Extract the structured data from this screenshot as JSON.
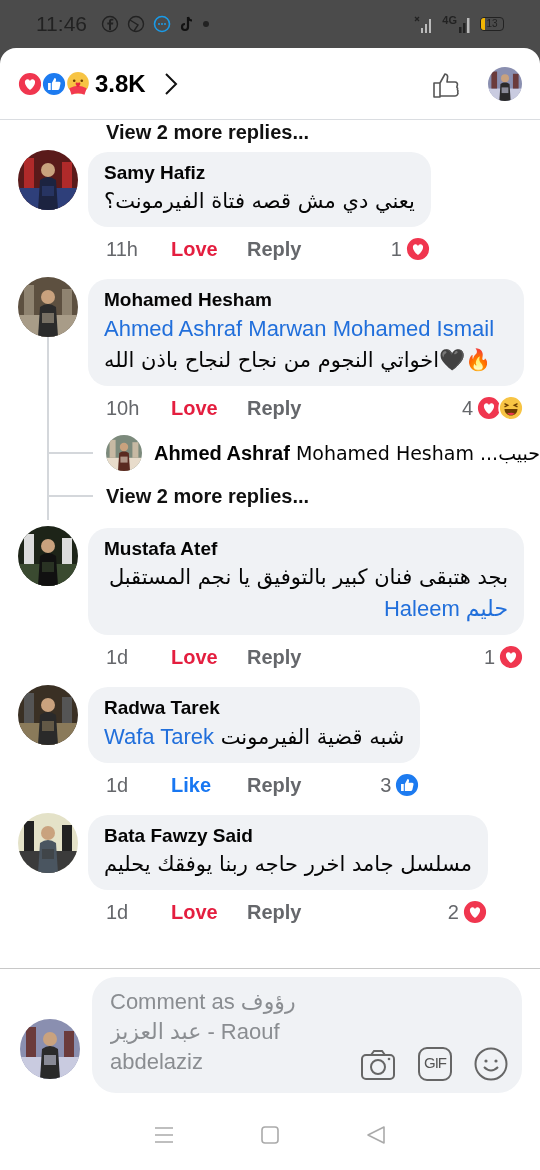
{
  "status_bar": {
    "time": "11:46",
    "network": "4G",
    "battery": "13"
  },
  "reactions_summary": {
    "reactions": [
      {
        "kind": "love"
      },
      {
        "kind": "like"
      },
      {
        "kind": "care"
      }
    ],
    "count": "3.8K"
  },
  "clipped_top_link": "View 2 more replies...",
  "comments": [
    {
      "name": "Samy Hafiz",
      "body": {
        "text": "يعني دي مش قصه فتاة الفيرمونت؟"
      },
      "time": "11h",
      "action": {
        "label": "Love",
        "kind": "love"
      },
      "reply_label": "Reply",
      "count": "1",
      "reactions": [
        {
          "kind": "love"
        }
      ]
    },
    {
      "name": "Mohamed Hesham",
      "body": {
        "mention_before": "Ahmed Ashraf Marwan Mohamed Ismail",
        "text": "اخواتي النجوم من نجاح لنجاح باذن الله🖤🔥"
      },
      "time": "10h",
      "action": {
        "label": "Love",
        "kind": "love"
      },
      "reply_label": "Reply",
      "count": "4",
      "reactions": [
        {
          "kind": "love"
        },
        {
          "kind": "haha"
        }
      ],
      "replies": [
        {
          "name": "Ahmed Ashraf",
          "preview": "Mohamed Hesham ...حبيب"
        }
      ],
      "more_replies": "View 2 more replies..."
    },
    {
      "name": "Mustafa Atef",
      "body": {
        "text": "بجد هتبقى فنان كبير بالتوفيق يا نجم المستقبل",
        "mention_after": "حليم Haleem"
      },
      "time": "1d",
      "action": {
        "label": "Love",
        "kind": "love"
      },
      "reply_label": "Reply",
      "count": "1",
      "reactions": [
        {
          "kind": "love"
        }
      ]
    },
    {
      "name": "Radwa Tarek",
      "body": {
        "mention_before": "Wafa Tarek",
        "text": "شبه قضية الفيرمونت"
      },
      "time": "1d",
      "action": {
        "label": "Like",
        "kind": "like"
      },
      "reply_label": "Reply",
      "count": "3",
      "reactions": [
        {
          "kind": "like"
        }
      ]
    },
    {
      "name": "Bata Fawzy Said",
      "body": {
        "text": "مسلسل جامد اخرر حاجه ربنا يوفقك يحليم"
      },
      "time": "1d",
      "action": {
        "label": "Love",
        "kind": "love"
      },
      "reply_label": "Reply",
      "count": "2",
      "reactions": [
        {
          "kind": "love"
        }
      ]
    }
  ],
  "composer": {
    "placeholder": "Comment as رؤوف عبد العزيز - Raouf abdelaziz",
    "gif_label": "GIF"
  }
}
